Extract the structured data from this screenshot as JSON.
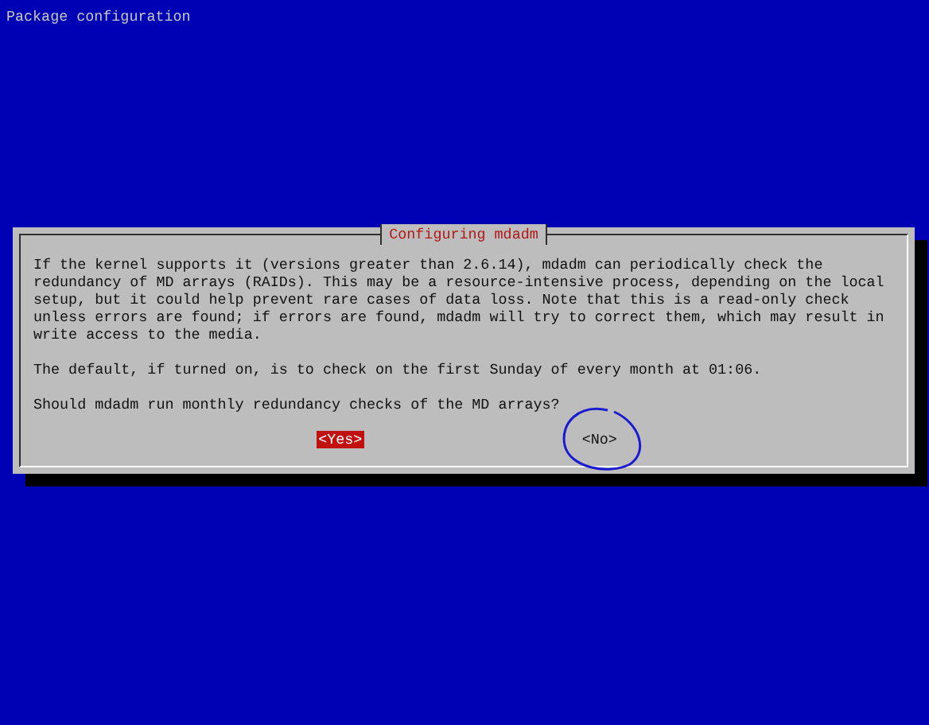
{
  "screen_title": "Package configuration",
  "dialog": {
    "title": "Configuring mdadm",
    "paragraphs": [
      "If the kernel supports it (versions greater than 2.6.14), mdadm can periodically check the redundancy of MD arrays (RAIDs). This may be a resource-intensive process, depending on the local setup, but it could help prevent rare cases of data loss. Note that this is a read-only check unless errors are found; if errors are found, mdadm will try to correct them, which may result in write access to the media.",
      "The default, if turned on, is to check on the first Sunday of every month at 01:06.",
      "Should mdadm run monthly redundancy checks of the MD arrays?"
    ],
    "buttons": [
      {
        "label": "<Yes>",
        "selected": true
      },
      {
        "label": "<No>",
        "selected": false
      }
    ]
  }
}
